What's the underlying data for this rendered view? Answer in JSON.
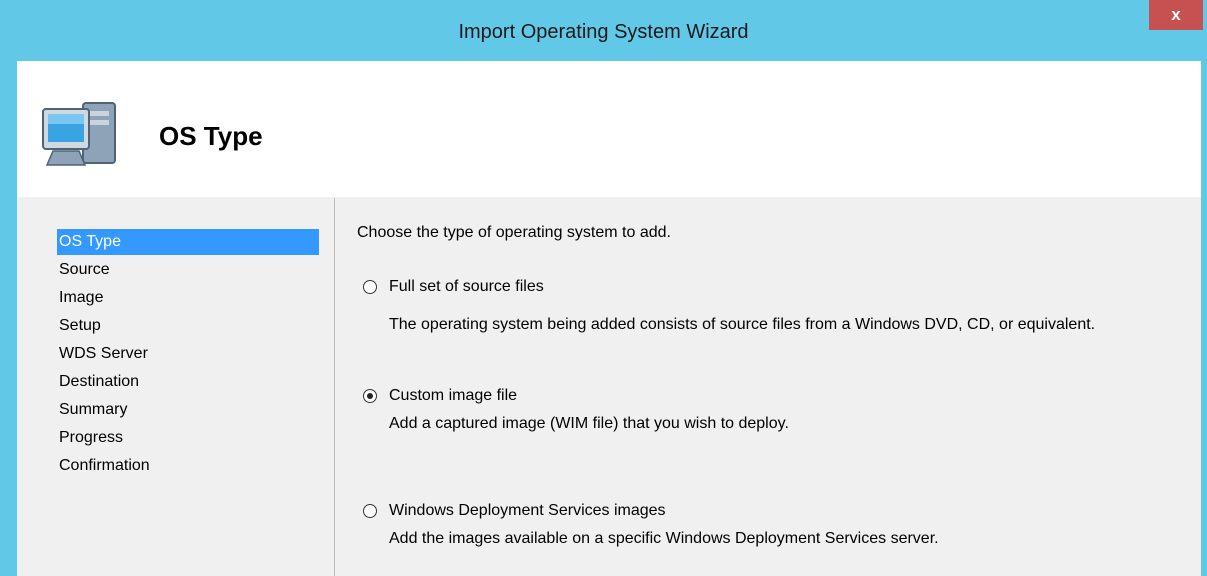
{
  "window": {
    "title": "Import Operating System Wizard",
    "close_label": "x"
  },
  "header": {
    "title": "OS Type",
    "icon": "computer-icon"
  },
  "nav": {
    "items": [
      {
        "label": "OS Type",
        "selected": true
      },
      {
        "label": "Source",
        "selected": false
      },
      {
        "label": "Image",
        "selected": false
      },
      {
        "label": "Setup",
        "selected": false
      },
      {
        "label": "WDS Server",
        "selected": false
      },
      {
        "label": "Destination",
        "selected": false
      },
      {
        "label": "Summary",
        "selected": false
      },
      {
        "label": "Progress",
        "selected": false
      },
      {
        "label": "Confirmation",
        "selected": false
      }
    ]
  },
  "main": {
    "prompt": "Choose the type of operating system to add.",
    "options": [
      {
        "label": "Full set of source files",
        "description": "The operating system being added consists of source files from a Windows DVD, CD, or equivalent.",
        "checked": false
      },
      {
        "label": "Custom image file",
        "description": "Add a captured image (WIM file) that you wish to deploy.",
        "checked": true
      },
      {
        "label": "Windows Deployment Services images",
        "description": "Add the images available on a specific Windows Deployment Services server.",
        "checked": false
      }
    ]
  },
  "colors": {
    "titlebar": "#62c8e8",
    "close_button": "#c75050",
    "selection": "#3399ff"
  }
}
